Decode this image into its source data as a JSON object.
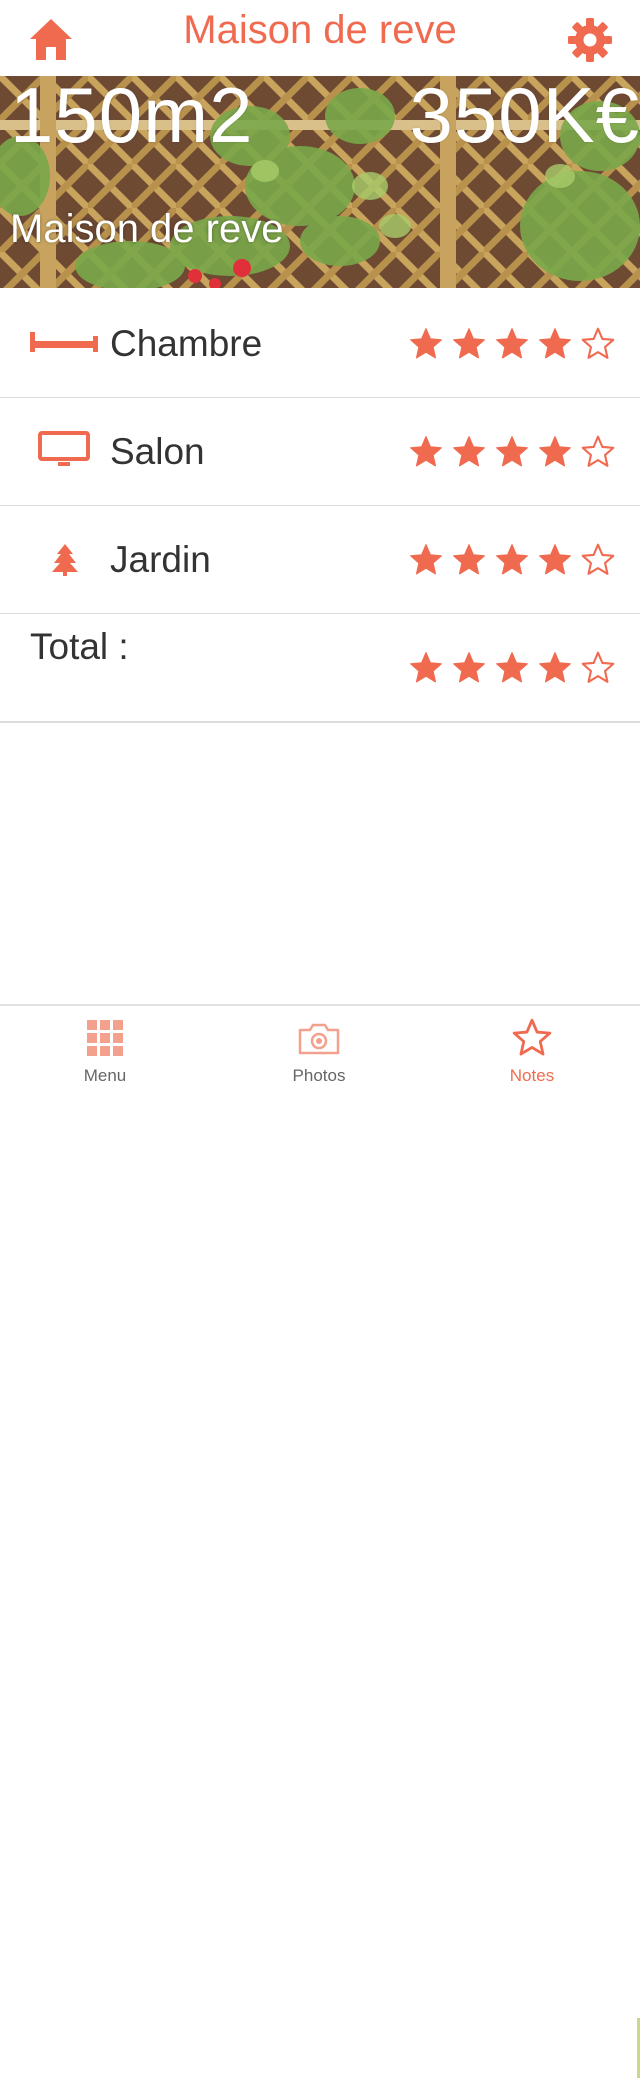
{
  "header": {
    "title": "Maison de reve",
    "home_icon": "home-icon",
    "settings_icon": "gear-icon"
  },
  "hero": {
    "area": "150m2",
    "price": "350K€",
    "name": "Maison de reve",
    "image": "garden-trellis-photo"
  },
  "colors": {
    "accent": "#f06a4f",
    "text": "#333333",
    "divider": "#dcdcdc"
  },
  "ratings": [
    {
      "label": "Chambre",
      "icon": "bed-icon",
      "stars": 4,
      "max": 5
    },
    {
      "label": "Salon",
      "icon": "tv-icon",
      "stars": 4,
      "max": 5
    },
    {
      "label": "Jardin",
      "icon": "tree-icon",
      "stars": 4,
      "max": 5
    }
  ],
  "total": {
    "label": "Total :",
    "stars": 4,
    "max": 5
  },
  "tabs": [
    {
      "label": "Menu",
      "icon": "grid-icon",
      "active": false
    },
    {
      "label": "Photos",
      "icon": "camera-icon",
      "active": false
    },
    {
      "label": "Notes",
      "icon": "star-icon",
      "active": true
    }
  ]
}
